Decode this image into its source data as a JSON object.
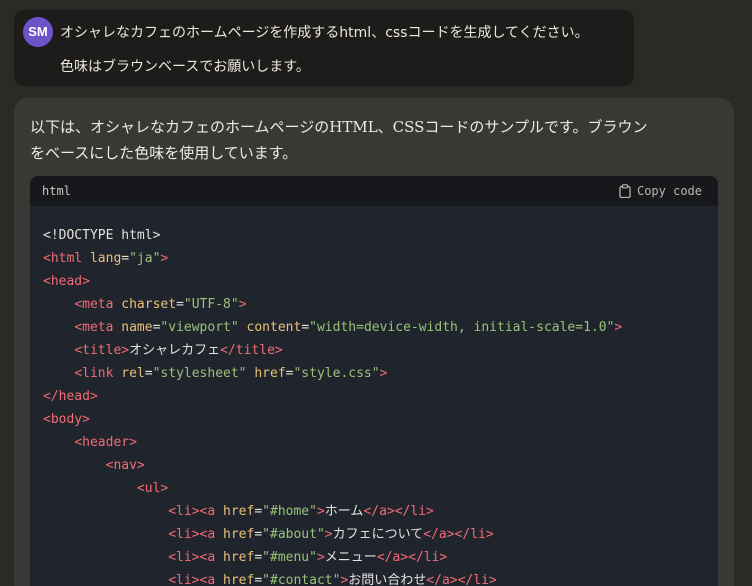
{
  "user": {
    "avatar_initials": "SM",
    "lines": [
      "オシャレなカフェのホームページを作成するhtml、cssコードを生成してください。",
      "色味はブラウンベースでお願いします。"
    ]
  },
  "assistant": {
    "intro_lines": [
      "以下は、オシャレなカフェのホームページのHTML、CSSコードのサンプルです。ブラウン",
      "をベースにした色味を使用しています。"
    ],
    "code_block": {
      "language": "html",
      "copy_label": "Copy code",
      "copy_icon": "clipboard-icon",
      "lines": [
        [
          {
            "t": "txt",
            "v": "<!DOCTYPE html>"
          }
        ],
        [
          {
            "t": "tag",
            "v": "<html "
          },
          {
            "t": "attr",
            "v": "lang"
          },
          {
            "t": "txt",
            "v": "="
          },
          {
            "t": "str",
            "v": "\"ja\""
          },
          {
            "t": "tag",
            "v": ">"
          }
        ],
        [
          {
            "t": "tag",
            "v": "<head>"
          }
        ],
        [
          {
            "t": "txt",
            "v": "    "
          },
          {
            "t": "tag",
            "v": "<meta "
          },
          {
            "t": "attr",
            "v": "charset"
          },
          {
            "t": "txt",
            "v": "="
          },
          {
            "t": "str",
            "v": "\"UTF-8\""
          },
          {
            "t": "tag",
            "v": ">"
          }
        ],
        [
          {
            "t": "txt",
            "v": "    "
          },
          {
            "t": "tag",
            "v": "<meta "
          },
          {
            "t": "attr",
            "v": "name"
          },
          {
            "t": "txt",
            "v": "="
          },
          {
            "t": "str",
            "v": "\"viewport\""
          },
          {
            "t": "txt",
            "v": " "
          },
          {
            "t": "attr",
            "v": "content"
          },
          {
            "t": "txt",
            "v": "="
          },
          {
            "t": "str",
            "v": "\"width=device-width, initial-scale=1.0\""
          },
          {
            "t": "tag",
            "v": ">"
          }
        ],
        [
          {
            "t": "txt",
            "v": "    "
          },
          {
            "t": "tag",
            "v": "<title>"
          },
          {
            "t": "txt",
            "v": "オシャレカフェ"
          },
          {
            "t": "tag",
            "v": "</title>"
          }
        ],
        [
          {
            "t": "txt",
            "v": "    "
          },
          {
            "t": "tag",
            "v": "<link "
          },
          {
            "t": "attr",
            "v": "rel"
          },
          {
            "t": "txt",
            "v": "="
          },
          {
            "t": "str",
            "v": "\"stylesheet\""
          },
          {
            "t": "txt",
            "v": " "
          },
          {
            "t": "attr",
            "v": "href"
          },
          {
            "t": "txt",
            "v": "="
          },
          {
            "t": "str",
            "v": "\"style.css\""
          },
          {
            "t": "tag",
            "v": ">"
          }
        ],
        [
          {
            "t": "tag",
            "v": "</head>"
          }
        ],
        [
          {
            "t": "tag",
            "v": "<body>"
          }
        ],
        [
          {
            "t": "txt",
            "v": "    "
          },
          {
            "t": "tag",
            "v": "<header>"
          }
        ],
        [
          {
            "t": "txt",
            "v": "        "
          },
          {
            "t": "tag",
            "v": "<nav>"
          }
        ],
        [
          {
            "t": "txt",
            "v": "            "
          },
          {
            "t": "tag",
            "v": "<ul>"
          }
        ],
        [
          {
            "t": "txt",
            "v": "                "
          },
          {
            "t": "tag",
            "v": "<li><a "
          },
          {
            "t": "attr",
            "v": "href"
          },
          {
            "t": "txt",
            "v": "="
          },
          {
            "t": "str",
            "v": "\"#home\""
          },
          {
            "t": "tag",
            "v": ">"
          },
          {
            "t": "txt",
            "v": "ホーム"
          },
          {
            "t": "tag",
            "v": "</a></li>"
          }
        ],
        [
          {
            "t": "txt",
            "v": "                "
          },
          {
            "t": "tag",
            "v": "<li><a "
          },
          {
            "t": "attr",
            "v": "href"
          },
          {
            "t": "txt",
            "v": "="
          },
          {
            "t": "str",
            "v": "\"#about\""
          },
          {
            "t": "tag",
            "v": ">"
          },
          {
            "t": "txt",
            "v": "カフェについて"
          },
          {
            "t": "tag",
            "v": "</a></li>"
          }
        ],
        [
          {
            "t": "txt",
            "v": "                "
          },
          {
            "t": "tag",
            "v": "<li><a "
          },
          {
            "t": "attr",
            "v": "href"
          },
          {
            "t": "txt",
            "v": "="
          },
          {
            "t": "str",
            "v": "\"#menu\""
          },
          {
            "t": "tag",
            "v": ">"
          },
          {
            "t": "txt",
            "v": "メニュー"
          },
          {
            "t": "tag",
            "v": "</a></li>"
          }
        ],
        [
          {
            "t": "txt",
            "v": "                "
          },
          {
            "t": "tag",
            "v": "<li><a "
          },
          {
            "t": "attr",
            "v": "href"
          },
          {
            "t": "txt",
            "v": "="
          },
          {
            "t": "str",
            "v": "\"#contact\""
          },
          {
            "t": "tag",
            "v": ">"
          },
          {
            "t": "txt",
            "v": "お問い合わせ"
          },
          {
            "t": "tag",
            "v": "</a></li>"
          }
        ]
      ]
    }
  },
  "colors": {
    "page_bg": "#2b2a27",
    "user_bubble_bg": "#1d1c1a",
    "avatar_bg": "#6b54c8",
    "assistant_bg": "#393835",
    "code_bg": "#20242c",
    "code_header_bg": "#17181b",
    "syntax_tag": "#f06c74",
    "syntax_attr": "#e6c07b",
    "syntax_string": "#98c379"
  }
}
